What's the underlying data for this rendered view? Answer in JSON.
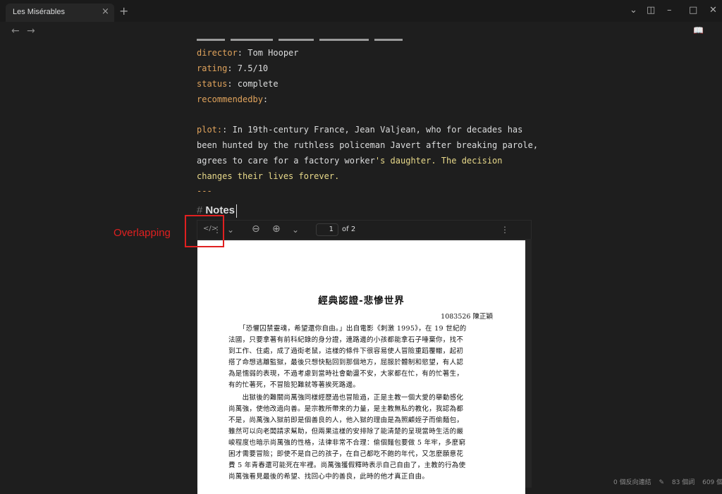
{
  "window": {
    "tab_title": "Les Misérables",
    "tab_close_icon": "×",
    "new_tab_icon": "+",
    "dropdown_icon": "⌄",
    "layout_icon": "◫",
    "minimize_icon": "–",
    "maximize_icon": "□",
    "close_icon": "✕"
  },
  "nav": {
    "back_icon": "←",
    "forward_icon": "→",
    "reading_view_icon": "📖"
  },
  "frontmatter": [
    {
      "key": "director",
      "value": ": Tom Hooper"
    },
    {
      "key": "rating",
      "value": ": 7.5/10"
    },
    {
      "key": "status",
      "value": ": complete"
    },
    {
      "key": "recommendedby",
      "value": ":"
    }
  ],
  "plot": {
    "key": "plot:",
    "lines": [
      ": In 19th-century France, Jean Valjean, who for decades has",
      "been hunted by the ruthless policeman Javert after breaking parole,"
    ],
    "line3_plain": "agrees to care for a factory worker",
    "line3_highlight": "'s daughter. The decision",
    "line4_highlight": "changes their lives forever.",
    "fence": "---"
  },
  "notes_heading": {
    "hash": "#",
    "text": "Notes"
  },
  "pdf_toolbar": {
    "source_icon": "</>",
    "more_vert_icon": "⋮",
    "chevron_icon": "⌄",
    "zoom_out_icon": "⊖",
    "zoom_in_icon": "⊕",
    "page_number": "1",
    "page_of": "of 2",
    "menu_icon": "⋮"
  },
  "pdf_page": {
    "title": "經典認證-悲慘世界",
    "author": "1083526 陳正穎",
    "lines": [
      "　　「恐懼囚禁靈魂，希望還你自由。」出自電影《刺激 1995》，在 19 世紀的",
      "法國，只要拿著有前科紀錄的身分證，連路邊的小孩都能拿石子唾棄你，找不",
      "到工作、住處，成了過街老鼠，這樣的條件下很容易使人冒險重蹈覆轍，起初",
      "搭了命想逃離監獄，最後只想快點回到那個地方，屈服於體制和慾望，有人認",
      "為是懦弱的表現，不過考慮到當時社會動盪不安，大家都在忙，有的忙著生，",
      "有的忙著死，不冒險犯難就等著挨死路邊。",
      "　　出獄後的難關尚萬強同樣經歷過也冒險過，正是主教一個大愛的舉動感化",
      "尚萬強，使他改過向善。是宗教所帶來的力量，是主教無私的教化，我認為都",
      "不是，尚萬強入獄前即是個善良的人，他入獄的理由是為照顧姪子而偷麵包，",
      "雖然可以向老闆請求幫助，但兩果這樣的安排除了能清楚的呈現當時生活的嚴",
      "峻程度也暗示尚萬強的性格，法律非常不合理：偷個麵包要做 5 年牢，多麼窮",
      "困才需要冒險；即使不是自己的孩子，在自己都吃不飽的年代，又怎麼願意花",
      "費 5 年青春還可能死在牢裡。尚萬強獲假釋時表示自己自由了，主教的行為使",
      "尚萬強看見最後的希望、找回心中的善良，此時的他才真正自由。"
    ]
  },
  "annotation": {
    "label": "Overlapping"
  },
  "status": {
    "backlinks": "0 個反向連結",
    "edit_icon": "✎",
    "words": "83 個詞",
    "chars": "609 個字元"
  }
}
